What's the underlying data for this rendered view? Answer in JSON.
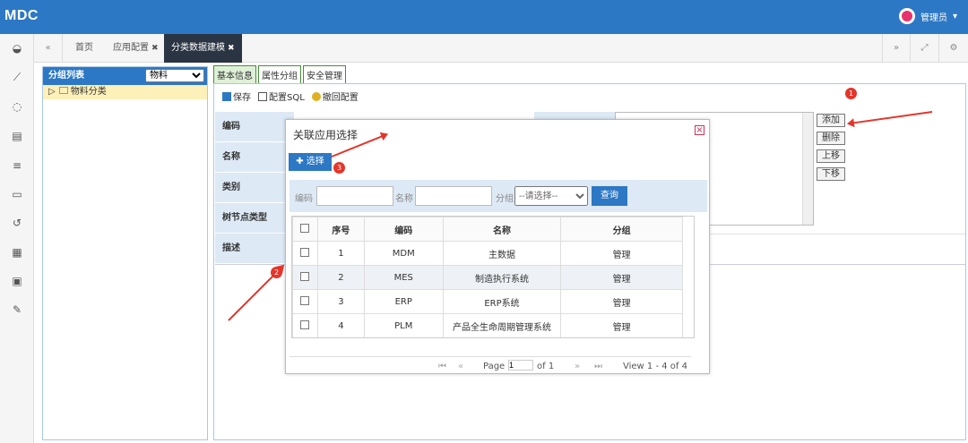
{
  "app": {
    "logo": "MDC",
    "user": "管理员"
  },
  "tabs": [
    {
      "label": "首页",
      "closable": false
    },
    {
      "label": "应用配置",
      "closable": true
    },
    {
      "label": "分类数据建模",
      "closable": true,
      "active": true
    }
  ],
  "tab_close_glyph": "✖",
  "left_panel": {
    "title": "分组列表",
    "selected": "物料",
    "tree_node": "物料分类"
  },
  "sub_tabs": [
    "基本信息",
    "属性分组",
    "安全管理"
  ],
  "toolbar": {
    "save": "保存",
    "config_sql": "配置SQL",
    "revoke": "撤回配置"
  },
  "form_labels": [
    "编码",
    "名称",
    "类别",
    "树节点类型",
    "描述"
  ],
  "side_buttons": [
    "添加",
    "删除",
    "上移",
    "下移"
  ],
  "dialog": {
    "title": "关联应用选择",
    "select_button": "选择",
    "search": {
      "code_label": "编码",
      "name_label": "名称",
      "group_label": "分组",
      "group_placeholder": "--请选择--",
      "query_button": "查询"
    },
    "columns": [
      "序号",
      "编码",
      "名称",
      "分组"
    ],
    "rows": [
      {
        "no": "1",
        "code": "MDM",
        "name": "主数据",
        "group": "管理"
      },
      {
        "no": "2",
        "code": "MES",
        "name": "制造执行系统",
        "group": "管理"
      },
      {
        "no": "3",
        "code": "ERP",
        "name": "ERP系统",
        "group": "管理"
      },
      {
        "no": "4",
        "code": "PLM",
        "name": "产品全生命周期管理系统",
        "group": "管理"
      }
    ],
    "pager": {
      "page_label": "Page",
      "page": "1",
      "of": "of 1",
      "view": "View 1 - 4 of 4"
    }
  },
  "annotations": {
    "b1": "1",
    "b2": "2",
    "b3": "3"
  },
  "colors": {
    "primary": "#2d78c4",
    "annotation": "#e5352a",
    "active_tab": "#2a3442"
  }
}
